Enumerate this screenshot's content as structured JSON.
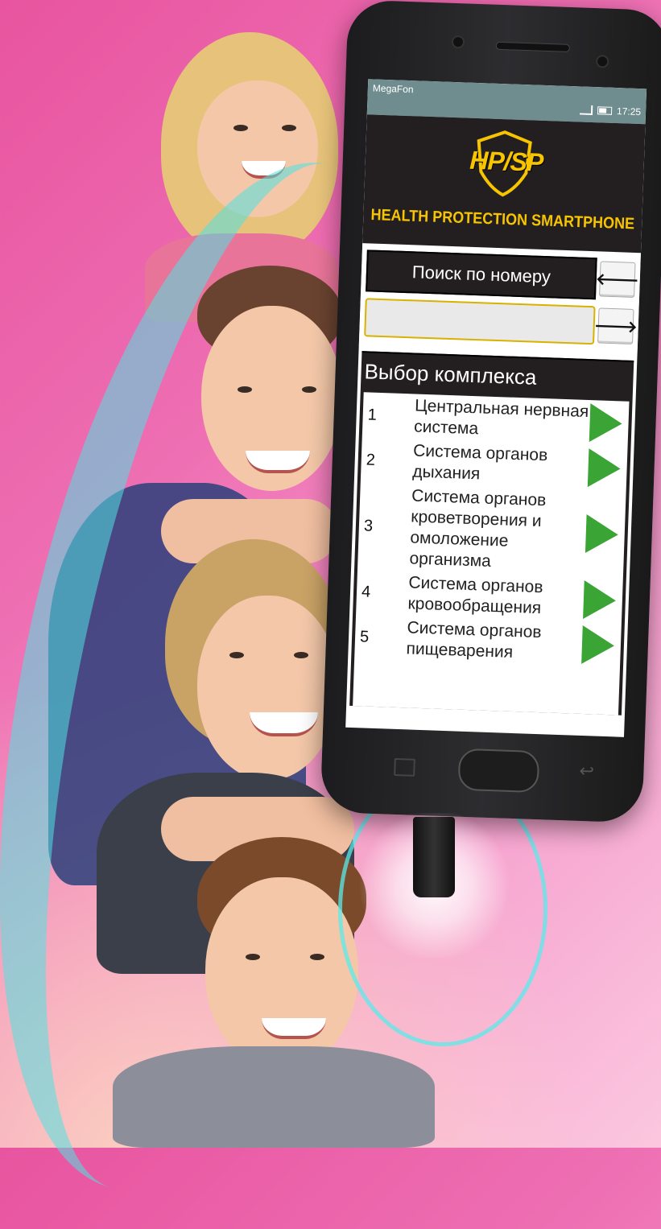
{
  "status_bar": {
    "carrier": "MegaFon",
    "time": "17:25",
    "icons": [
      "signal-icon",
      "battery-icon"
    ]
  },
  "app": {
    "logo_text": "HP/SP",
    "tagline": "HEALTH PROTECTION SMARTPHONE",
    "brand_color": "#f6c400"
  },
  "search": {
    "label": "Поиск по номеру",
    "back_icon": "🡐",
    "go_icon": "🡒",
    "input_value": "",
    "input_placeholder": ""
  },
  "complex": {
    "title": "Выбор комплекса",
    "items": [
      {
        "num": "1",
        "label": "Центральная нервная система"
      },
      {
        "num": "2",
        "label": "Система органов дыхания"
      },
      {
        "num": "3",
        "label": "Система органов кроветворения и омоложение организма"
      },
      {
        "num": "4",
        "label": "Система органов кровообращения"
      },
      {
        "num": "5",
        "label": "Система органов пищеварения"
      }
    ],
    "play_color": "#3aa535"
  }
}
